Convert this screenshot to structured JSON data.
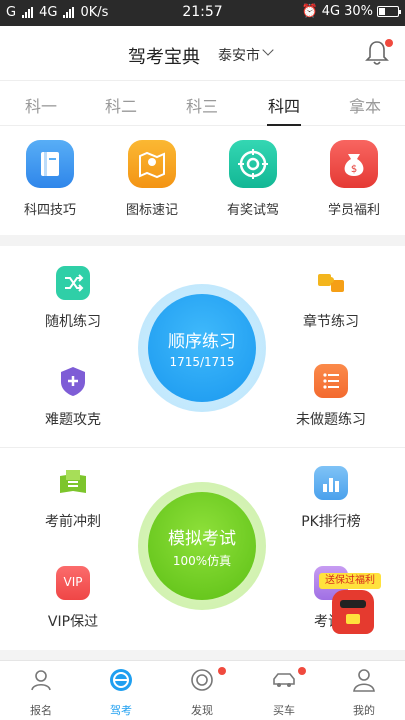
{
  "status_bar": {
    "network_g": "G",
    "network_4g": "4G",
    "speed": "0K/s",
    "time": "21:57",
    "net_right": "4G",
    "battery": "30%"
  },
  "header": {
    "title": "驾考宝典",
    "city": "泰安市"
  },
  "tabs": [
    "科一",
    "科二",
    "科三",
    "科四",
    "拿本"
  ],
  "active_tab": "科四",
  "quick_links": [
    {
      "label": "科四技巧",
      "icon": "book-icon",
      "color": "#3d95f0"
    },
    {
      "label": "图标速记",
      "icon": "map-icon",
      "color": "#f6a01a"
    },
    {
      "label": "有奖试驾",
      "icon": "target-icon",
      "color": "#1cc7a4"
    },
    {
      "label": "学员福利",
      "icon": "money-bag-icon",
      "color": "#ef4a44"
    }
  ],
  "practice": {
    "random": "随机练习",
    "chapter": "章节练习",
    "hard": "难题攻克",
    "undone": "未做题练习",
    "sequential_title": "顺序练习",
    "sequential_progress": "1715/1715",
    "sprint": "考前冲刺",
    "pk_rank": "PK排行榜",
    "vip": "VIP保过",
    "exam_label": "考试",
    "mock_title": "模拟考试",
    "mock_sub": "100%仿真",
    "promo_badge": "送保过福利",
    "vip_icon_text": "VIP"
  },
  "tabbar": [
    "报名",
    "驾考",
    "发现",
    "买车",
    "我的"
  ],
  "active_nav": "驾考",
  "colors": {
    "accent_blue": "#1f9ff0",
    "accent_green": "#6ccf1f",
    "badge_red": "#f04a3e"
  }
}
